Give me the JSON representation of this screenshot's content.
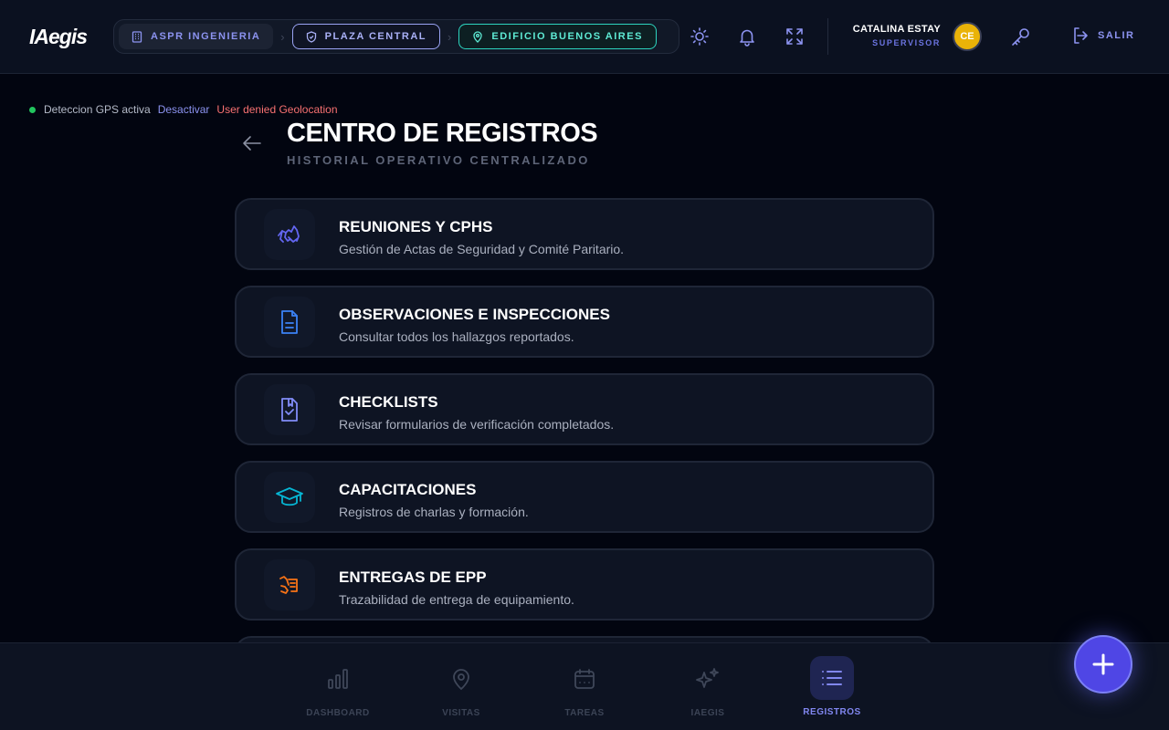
{
  "header": {
    "logo": "IAegis",
    "breadcrumbs": [
      {
        "label": "ASPR INGENIERIA",
        "icon": "building-icon"
      },
      {
        "label": "PLAZA CENTRAL",
        "icon": "shield-icon"
      },
      {
        "label": "EDIFICIO BUENOS AIRES",
        "icon": "map-pin-icon"
      }
    ],
    "user": {
      "name": "CATALINA ESTAY",
      "role": "SUPERVISOR",
      "initials": "CE"
    },
    "logout_label": "SALIR"
  },
  "gps": {
    "status": "Deteccion GPS activa",
    "toggle_label": "Desactivar",
    "error": "User denied Geolocation"
  },
  "page": {
    "title": "CENTRO DE REGISTROS",
    "subtitle": "HISTORIAL OPERATIVO CENTRALIZADO"
  },
  "cards": [
    {
      "title": "REUNIONES Y CPHS",
      "desc": "Gestión de Actas de Seguridad y Comité Paritario.",
      "icon": "handshake-icon",
      "color": "#6366f1"
    },
    {
      "title": "OBSERVACIONES E INSPECCIONES",
      "desc": "Consultar todos los hallazgos reportados.",
      "icon": "document-icon",
      "color": "#3b82f6"
    },
    {
      "title": "CHECKLISTS",
      "desc": "Revisar formularios de verificación completados.",
      "icon": "checklist-icon",
      "color": "#818cf8"
    },
    {
      "title": "CAPACITACIONES",
      "desc": "Registros de charlas y formación.",
      "icon": "graduation-cap-icon",
      "color": "#06b6d4"
    },
    {
      "title": "ENTREGAS DE EPP",
      "desc": "Trazabilidad de entrega de equipamiento.",
      "icon": "delivery-icon",
      "color": "#f97316"
    }
  ],
  "nav": [
    {
      "label": "DASHBOARD",
      "icon": "bar-chart-icon"
    },
    {
      "label": "VISITAS",
      "icon": "map-pin-icon"
    },
    {
      "label": "TAREAS",
      "icon": "calendar-icon"
    },
    {
      "label": "IAEGIS",
      "icon": "sparkles-icon"
    },
    {
      "label": "REGISTROS",
      "icon": "list-icon"
    }
  ],
  "colors": {
    "accent": "#4f46e5",
    "background": "#020510",
    "active_nav": "#8187f0",
    "gps_active": "#22c55e",
    "error": "#f87171"
  }
}
